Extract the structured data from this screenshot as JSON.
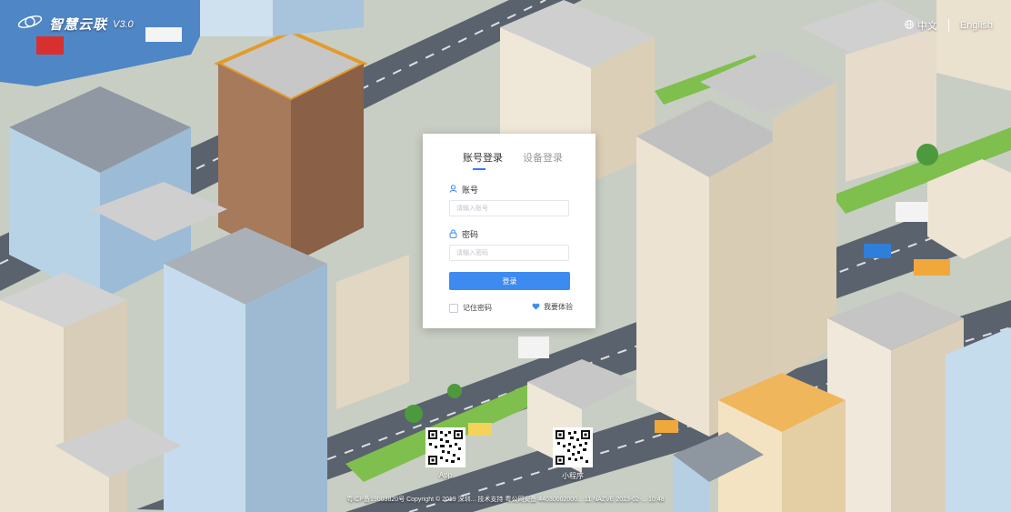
{
  "brand": {
    "title": "智慧云联",
    "version": "V3.0",
    "logo_icon": "planet-logo-icon"
  },
  "lang": {
    "chinese": "中文",
    "english": "English",
    "icon": "globe-icon"
  },
  "login": {
    "tabs": [
      {
        "label": "账号登录"
      },
      {
        "label": "设备登录"
      }
    ],
    "account_label": "账号",
    "account_placeholder": "请输入账号",
    "password_label": "密码",
    "password_placeholder": "请输入密码",
    "submit_label": "登录",
    "remember_label": "记住密码",
    "trial_label": "我要体验"
  },
  "qr": {
    "app_label": "App",
    "mini_label": "小程序"
  },
  "footer": {
    "text": "粤ICP备19003820号 Copyright © 2019 深圳... 技术支持 粤公网安备 44030002000... 11 NAZVE 2023-02-... 10:48"
  },
  "colors": {
    "accent": "#3d8bf0",
    "tab_active": "#333333",
    "tab_inactive": "#999999"
  }
}
